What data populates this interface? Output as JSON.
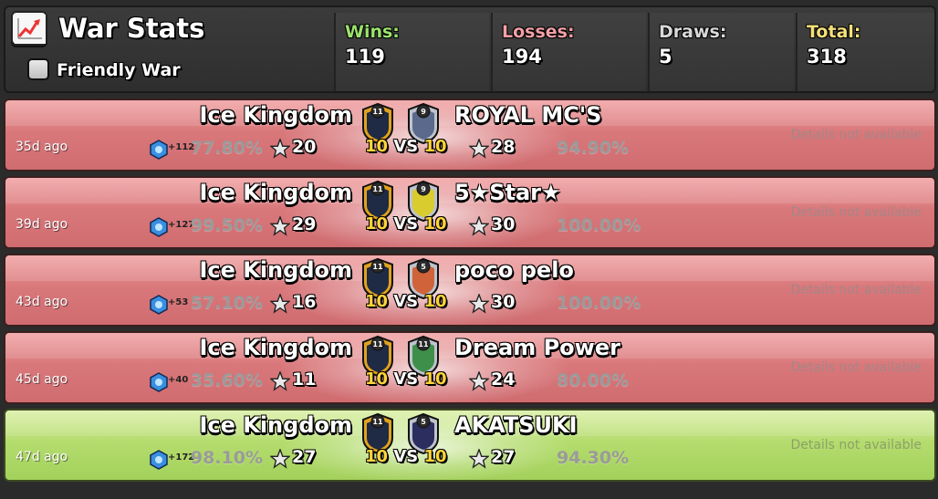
{
  "header": {
    "title": "War Stats",
    "icon": "chart-icon",
    "friendly_war_label": "Friendly War",
    "friendly_war_checked": false,
    "stats": [
      {
        "label": "Wins:",
        "value": "119",
        "color": "#9be36c"
      },
      {
        "label": "Losses:",
        "value": "194",
        "color": "#f3a0a6"
      },
      {
        "label": "Draws:",
        "value": "5",
        "color": "#d8d8d8"
      },
      {
        "label": "Total:",
        "value": "318",
        "color": "#f4e07a"
      }
    ]
  },
  "colors": {
    "loss_row": "#d9787b",
    "win_row": "#b4dc6e",
    "vs_yellow": "#ffd43a"
  },
  "wars": [
    {
      "ago": "35d ago",
      "result": "loss",
      "trophies": "+112",
      "our_clan": "Ice Kingdom",
      "our_level": "11",
      "our_pct": "77.80%",
      "our_stars": "20",
      "opp_clan": "ROYAL MC'S",
      "opp_level": "9",
      "opp_pct": "94.90%",
      "opp_stars": "28",
      "size_left": "10",
      "vs": "VS",
      "size_right": "10",
      "details": "Details not available",
      "opp_badge_color": "#5b6a8c"
    },
    {
      "ago": "39d ago",
      "result": "loss",
      "trophies": "+127",
      "our_clan": "Ice Kingdom",
      "our_level": "11",
      "our_pct": "99.50%",
      "our_stars": "29",
      "opp_clan": "5★Star★",
      "opp_level": "9",
      "opp_pct": "100.00%",
      "opp_stars": "30",
      "size_left": "10",
      "vs": "VS",
      "size_right": "10",
      "details": "Details not available",
      "opp_badge_color": "#d9cc2e"
    },
    {
      "ago": "43d ago",
      "result": "loss",
      "trophies": "+53",
      "our_clan": "Ice Kingdom",
      "our_level": "11",
      "our_pct": "57.10%",
      "our_stars": "16",
      "opp_clan": "poco pelo",
      "opp_level": "5",
      "opp_pct": "100.00%",
      "opp_stars": "30",
      "size_left": "10",
      "vs": "VS",
      "size_right": "10",
      "details": "Details not available",
      "opp_badge_color": "#d0633a"
    },
    {
      "ago": "45d ago",
      "result": "loss",
      "trophies": "+40",
      "our_clan": "Ice Kingdom",
      "our_level": "11",
      "our_pct": "35.60%",
      "our_stars": "11",
      "opp_clan": "Dream Power",
      "opp_level": "11",
      "opp_pct": "80.00%",
      "opp_stars": "24",
      "size_left": "10",
      "vs": "VS",
      "size_right": "10",
      "details": "Details not available",
      "opp_badge_color": "#3e8f4a"
    },
    {
      "ago": "47d ago",
      "result": "win",
      "trophies": "+172",
      "our_clan": "Ice Kingdom",
      "our_level": "11",
      "our_pct": "98.10%",
      "our_stars": "27",
      "opp_clan": "AKATSUKI",
      "opp_level": "5",
      "opp_pct": "94.30%",
      "opp_stars": "27",
      "size_left": "10",
      "vs": "VS",
      "size_right": "10",
      "details": "Details not available",
      "opp_badge_color": "#2b2e5e"
    }
  ]
}
